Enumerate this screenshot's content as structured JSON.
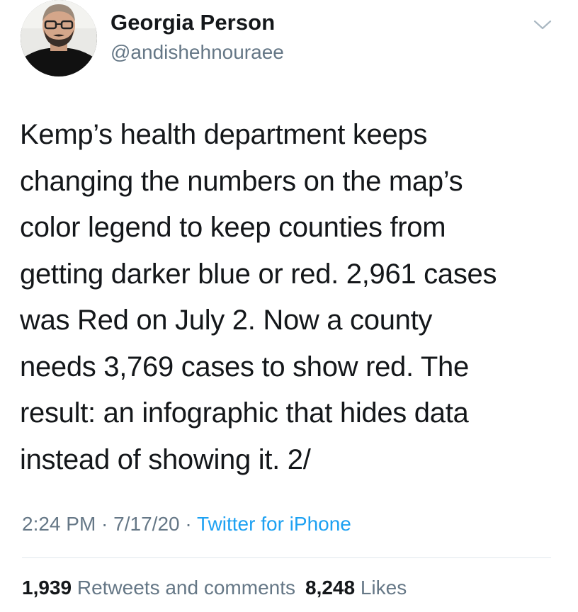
{
  "user": {
    "display_name": "Georgia Person",
    "handle": "@andishehnouraee"
  },
  "tweet": {
    "text": "Kemp’s health department keeps\nchanging the numbers on the map’s\ncolor legend to keep counties from\ngetting darker blue or red. 2,961 cases\nwas Red on July 2. Now a county\nneeds 3,769 cases to show red. The\nresult: an infographic that hides data\ninstead of showing it. 2/",
    "time": "2:24 PM",
    "date": "7/17/20",
    "separator": " · ",
    "source": "Twitter for iPhone"
  },
  "stats": {
    "retweets_count": "1,939",
    "retweets_label": "Retweets and comments",
    "likes_count": "8,248",
    "likes_label": "Likes"
  },
  "icons": {
    "menu": "chevron-down-icon",
    "avatar": "profile-photo"
  },
  "colors": {
    "text": "#14171a",
    "secondary": "#657786",
    "link": "#1da1f2",
    "divider": "#e1e8ed"
  }
}
